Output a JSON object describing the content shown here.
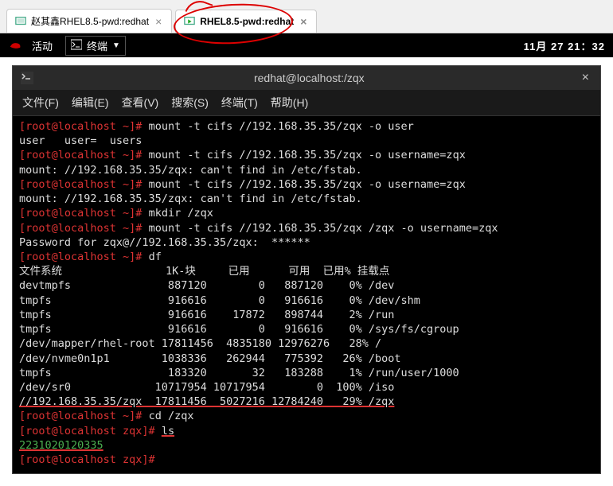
{
  "tabs": {
    "t0": {
      "label": "赵其鑫RHEL8.5-pwd:redhat"
    },
    "t1": {
      "label": "RHEL8.5-pwd:redhat"
    }
  },
  "topbar": {
    "activities": "活动",
    "terminal": "终端",
    "datetime": "11月 27  21：32"
  },
  "term": {
    "title": "redhat@localhost:/zqx",
    "menu": {
      "file": "文件(F)",
      "edit": "编辑(E)",
      "view": "查看(V)",
      "search": "搜索(S)",
      "terminal": "终端(T)",
      "help": "帮助(H)"
    },
    "lines": {
      "l0a": "[root@localhost ~]# ",
      "l0b": "mount -t cifs //192.168.35.35/zqx -o user",
      "l1": "user   user=  users",
      "l2a": "[root@localhost ~]# ",
      "l2b": "mount -t cifs //192.168.35.35/zqx -o username=zqx",
      "l3": "mount: //192.168.35.35/zqx: can't find in /etc/fstab.",
      "l4a": "[root@localhost ~]# ",
      "l4b": "mount -t cifs //192.168.35.35/zqx -o username=zqx",
      "l5": "mount: //192.168.35.35/zqx: can't find in /etc/fstab.",
      "l6a": "[root@localhost ~]# ",
      "l6b": "mkdir /zqx",
      "l7a": "[root@localhost ~]# ",
      "l7b": "mount -t cifs //192.168.35.35/zqx /zqx -o username=zqx",
      "l8": "Password for zqx@//192.168.35.35/zqx:  ******",
      "l9a": "[root@localhost ~]# ",
      "l9b": "df",
      "h": "文件系统                1K-块     已用      可用  已用% 挂载点",
      "d0": "devtmpfs               887120        0   887120    0% /dev",
      "d1": "tmpfs                  916616        0   916616    0% /dev/shm",
      "d2": "tmpfs                  916616    17872   898744    2% /run",
      "d3": "tmpfs                  916616        0   916616    0% /sys/fs/cgroup",
      "d4": "/dev/mapper/rhel-root 17811456  4835180 12976276   28% /",
      "d5": "/dev/nvme0n1p1        1038336   262944   775392   26% /boot",
      "d6": "tmpfs                  183320       32   183288    1% /run/user/1000",
      "d7": "/dev/sr0             10717954 10717954        0  100% /iso",
      "d8": "//192.168.35.35/zqx  17811456  5027216 12784240   29% /zqx",
      "l10a": "[root@localhost ~]# ",
      "l10b": "cd /zqx",
      "l11a": "[root@localhost zqx]# ",
      "l11b": "ls",
      "l12": "2231020120335",
      "l13": "[root@localhost zqx]# "
    }
  }
}
